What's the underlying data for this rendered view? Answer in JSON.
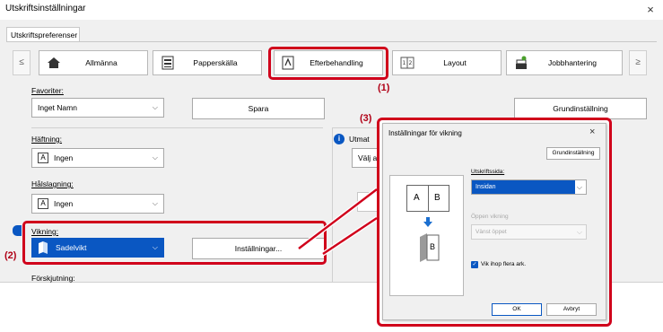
{
  "window": {
    "title": "Utskriftsinställningar",
    "close": "×"
  },
  "tab": {
    "label": "Utskriftspreferenser"
  },
  "nav": {
    "prev": "≤",
    "next": "≥"
  },
  "categories": [
    {
      "label": "Allmänna",
      "icon": "home-icon"
    },
    {
      "label": "Papperskälla",
      "icon": "paper-tray-icon"
    },
    {
      "label": "Efterbehandling",
      "icon": "finishing-icon"
    },
    {
      "label": "Layout",
      "icon": "layout-icon"
    },
    {
      "label": "Jobbhantering",
      "icon": "job-handling-icon"
    }
  ],
  "favorites": {
    "label": "Favoriter:",
    "value": "Inget Namn",
    "save": "Spara",
    "default_btn": "Grundinställning"
  },
  "stapling": {
    "label": "Häftning:",
    "value": "Ingen"
  },
  "punch": {
    "label": "Hålslagning:",
    "value": "Ingen"
  },
  "folding": {
    "label": "Vikning:",
    "value": "Sadelvikt",
    "settings_btn": "Inställningar..."
  },
  "shift": {
    "label": "Förskjutning:"
  },
  "output": {
    "label": "Utmat",
    "value": "Välj a"
  },
  "callouts": {
    "one": "(1)",
    "two": "(2)",
    "three": "(3)"
  },
  "dialog": {
    "title": "Inställningar för vikning",
    "close": "×",
    "default_btn": "Grundinställning",
    "print_side_label": "Utskriftssida:",
    "print_side_value": "Insidan",
    "open_fold_label": "Öppen vikning",
    "open_fold_value": "Vänst öppet",
    "checkbox_label": "Vik ihop flera ark.",
    "preview": {
      "a": "A",
      "b": "B"
    },
    "ok": "OK",
    "cancel": "Avbryt"
  },
  "colors": {
    "accent": "#0a57c2",
    "callout_red": "#d0001b"
  }
}
